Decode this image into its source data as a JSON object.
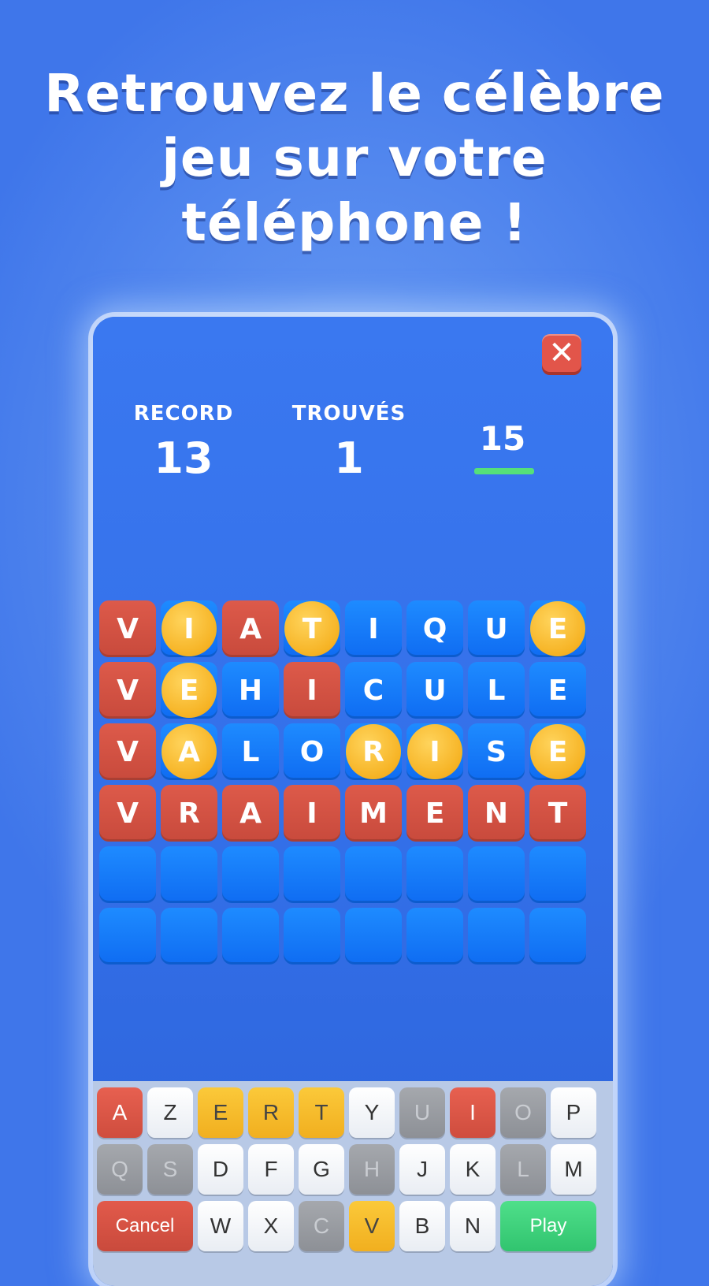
{
  "headline": [
    "Retrouvez le célèbre",
    "jeu sur votre",
    "téléphone !"
  ],
  "close_icon": "close-x-icon",
  "stats": {
    "record_label": "RECORD",
    "record_value": "13",
    "found_label": "TROUVÉS",
    "found_value": "1",
    "timer": "15"
  },
  "colors": {
    "correct": "#d35446",
    "misplaced": "#f6b324",
    "absent": "#1078f5",
    "timer_bar": "#55e07a"
  },
  "grid": [
    [
      {
        "l": "V",
        "s": "red"
      },
      {
        "l": "I",
        "s": "yellow"
      },
      {
        "l": "A",
        "s": "red"
      },
      {
        "l": "T",
        "s": "yellow"
      },
      {
        "l": "I",
        "s": "blue"
      },
      {
        "l": "Q",
        "s": "blue"
      },
      {
        "l": "U",
        "s": "blue"
      },
      {
        "l": "E",
        "s": "yellow"
      }
    ],
    [
      {
        "l": "V",
        "s": "red"
      },
      {
        "l": "E",
        "s": "yellow"
      },
      {
        "l": "H",
        "s": "blue"
      },
      {
        "l": "I",
        "s": "red"
      },
      {
        "l": "C",
        "s": "blue"
      },
      {
        "l": "U",
        "s": "blue"
      },
      {
        "l": "L",
        "s": "blue"
      },
      {
        "l": "E",
        "s": "blue"
      }
    ],
    [
      {
        "l": "V",
        "s": "red"
      },
      {
        "l": "A",
        "s": "yellow"
      },
      {
        "l": "L",
        "s": "blue"
      },
      {
        "l": "O",
        "s": "blue"
      },
      {
        "l": "R",
        "s": "yellow"
      },
      {
        "l": "I",
        "s": "yellow"
      },
      {
        "l": "S",
        "s": "blue"
      },
      {
        "l": "E",
        "s": "yellow"
      }
    ],
    [
      {
        "l": "V",
        "s": "red"
      },
      {
        "l": "R",
        "s": "red"
      },
      {
        "l": "A",
        "s": "red"
      },
      {
        "l": "I",
        "s": "red"
      },
      {
        "l": "M",
        "s": "red"
      },
      {
        "l": "E",
        "s": "red"
      },
      {
        "l": "N",
        "s": "red"
      },
      {
        "l": "T",
        "s": "red"
      }
    ],
    [
      {
        "l": "",
        "s": "empty"
      },
      {
        "l": "",
        "s": "empty"
      },
      {
        "l": "",
        "s": "empty"
      },
      {
        "l": "",
        "s": "empty"
      },
      {
        "l": "",
        "s": "empty"
      },
      {
        "l": "",
        "s": "empty"
      },
      {
        "l": "",
        "s": "empty"
      },
      {
        "l": "",
        "s": "empty"
      }
    ],
    [
      {
        "l": "",
        "s": "empty"
      },
      {
        "l": "",
        "s": "empty"
      },
      {
        "l": "",
        "s": "empty"
      },
      {
        "l": "",
        "s": "empty"
      },
      {
        "l": "",
        "s": "empty"
      },
      {
        "l": "",
        "s": "empty"
      },
      {
        "l": "",
        "s": "empty"
      },
      {
        "l": "",
        "s": "empty"
      }
    ]
  ],
  "keyboard": {
    "row1": [
      {
        "k": "A",
        "s": "red"
      },
      {
        "k": "Z",
        "s": "white"
      },
      {
        "k": "E",
        "s": "yellow"
      },
      {
        "k": "R",
        "s": "yellow"
      },
      {
        "k": "T",
        "s": "yellow"
      },
      {
        "k": "Y",
        "s": "white"
      },
      {
        "k": "U",
        "s": "gray"
      },
      {
        "k": "I",
        "s": "red"
      },
      {
        "k": "O",
        "s": "gray"
      },
      {
        "k": "P",
        "s": "white"
      }
    ],
    "row2": [
      {
        "k": "Q",
        "s": "gray"
      },
      {
        "k": "S",
        "s": "gray"
      },
      {
        "k": "D",
        "s": "white"
      },
      {
        "k": "F",
        "s": "white"
      },
      {
        "k": "G",
        "s": "white"
      },
      {
        "k": "H",
        "s": "gray"
      },
      {
        "k": "J",
        "s": "white"
      },
      {
        "k": "K",
        "s": "white"
      },
      {
        "k": "L",
        "s": "gray"
      },
      {
        "k": "M",
        "s": "white"
      }
    ],
    "cancel_label": "Cancel",
    "row3": [
      {
        "k": "W",
        "s": "white"
      },
      {
        "k": "X",
        "s": "white"
      },
      {
        "k": "C",
        "s": "gray"
      },
      {
        "k": "V",
        "s": "yellow"
      },
      {
        "k": "B",
        "s": "white"
      },
      {
        "k": "N",
        "s": "white"
      }
    ],
    "play_label": "Play"
  }
}
